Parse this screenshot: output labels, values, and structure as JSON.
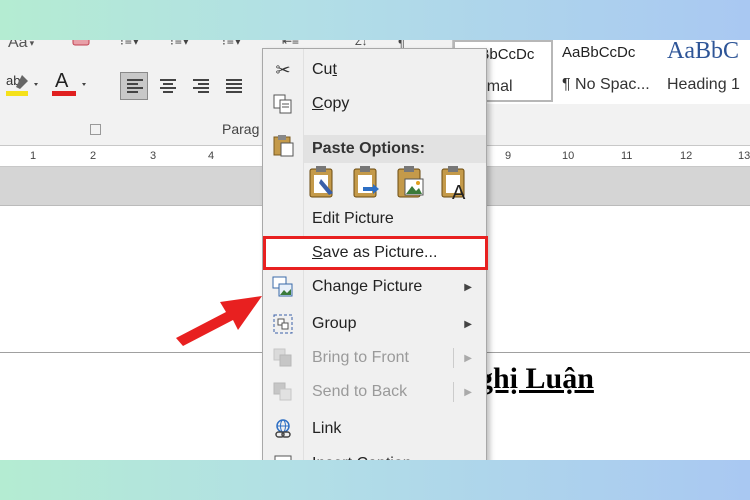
{
  "ribbon": {
    "font_group": {
      "change_case_label": "Aa",
      "highlight_label": "ab",
      "font_color_label": "A",
      "highlight_color": "#f5e11a",
      "font_color": "#e02020"
    },
    "paragraph_group": {
      "label": "Parag",
      "alignment_selected": "left"
    },
    "styles": [
      {
        "sample": "AaBbCcDc",
        "name": "Normal",
        "selected": true
      },
      {
        "sample": "AaBbCcDc",
        "name": "¶ No Spac..."
      },
      {
        "sample": "AaBbC",
        "name": "Heading 1"
      }
    ]
  },
  "ruler": {
    "ticks": [
      "1",
      "2",
      "3",
      "4",
      "9",
      "10",
      "11",
      "12",
      "13"
    ]
  },
  "document": {
    "heading_text": "ghị Luận"
  },
  "context_menu": {
    "items": [
      {
        "label": "Cut",
        "icon": "scissors-icon",
        "accel": "t"
      },
      {
        "label": "Copy",
        "icon": "copy-icon",
        "accel": "C"
      },
      {
        "label": "Edit Picture",
        "icon": "none"
      },
      {
        "label": "Save as Picture...",
        "icon": "none",
        "accel": "S",
        "highlighted": true
      },
      {
        "label": "Change Picture",
        "icon": "change-picture-icon",
        "submenu": true
      },
      {
        "label": "Group",
        "icon": "group-icon",
        "submenu": true
      },
      {
        "label": "Bring to Front",
        "icon": "bring-to-front-icon",
        "submenu": true,
        "disabled": true
      },
      {
        "label": "Send to Back",
        "icon": "send-to-back-icon",
        "submenu": true,
        "disabled": true
      },
      {
        "label": "Link",
        "icon": "link-icon"
      },
      {
        "label": "Insert Caption...",
        "icon": "caption-icon"
      }
    ],
    "paste_options": {
      "header": "Paste Options:",
      "options": [
        "keep-source-formatting",
        "merge-formatting",
        "picture",
        "keep-text-only"
      ]
    }
  },
  "annotation": {
    "highlight_color": "#e82020",
    "arrow_color": "#e82020"
  }
}
